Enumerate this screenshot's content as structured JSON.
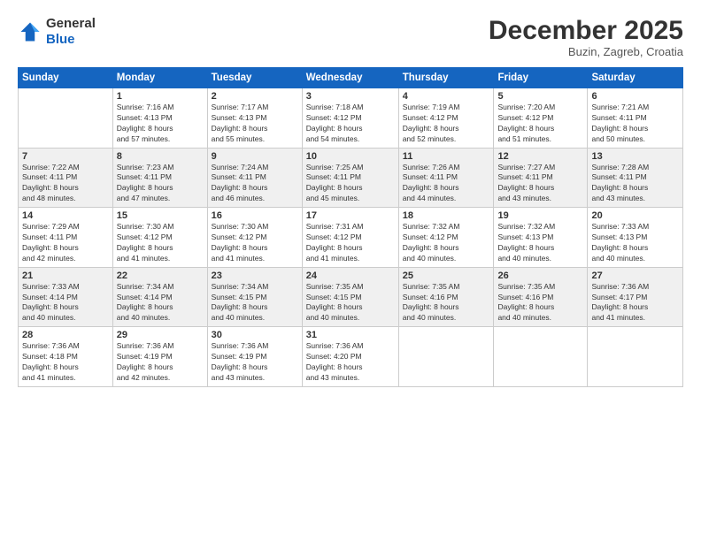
{
  "header": {
    "logo_general": "General",
    "logo_blue": "Blue",
    "month_title": "December 2025",
    "location": "Buzin, Zagreb, Croatia"
  },
  "weekdays": [
    "Sunday",
    "Monday",
    "Tuesday",
    "Wednesday",
    "Thursday",
    "Friday",
    "Saturday"
  ],
  "weeks": [
    [
      {
        "day": "",
        "info": ""
      },
      {
        "day": "1",
        "info": "Sunrise: 7:16 AM\nSunset: 4:13 PM\nDaylight: 8 hours\nand 57 minutes."
      },
      {
        "day": "2",
        "info": "Sunrise: 7:17 AM\nSunset: 4:13 PM\nDaylight: 8 hours\nand 55 minutes."
      },
      {
        "day": "3",
        "info": "Sunrise: 7:18 AM\nSunset: 4:12 PM\nDaylight: 8 hours\nand 54 minutes."
      },
      {
        "day": "4",
        "info": "Sunrise: 7:19 AM\nSunset: 4:12 PM\nDaylight: 8 hours\nand 52 minutes."
      },
      {
        "day": "5",
        "info": "Sunrise: 7:20 AM\nSunset: 4:12 PM\nDaylight: 8 hours\nand 51 minutes."
      },
      {
        "day": "6",
        "info": "Sunrise: 7:21 AM\nSunset: 4:11 PM\nDaylight: 8 hours\nand 50 minutes."
      }
    ],
    [
      {
        "day": "7",
        "info": "Sunrise: 7:22 AM\nSunset: 4:11 PM\nDaylight: 8 hours\nand 48 minutes."
      },
      {
        "day": "8",
        "info": "Sunrise: 7:23 AM\nSunset: 4:11 PM\nDaylight: 8 hours\nand 47 minutes."
      },
      {
        "day": "9",
        "info": "Sunrise: 7:24 AM\nSunset: 4:11 PM\nDaylight: 8 hours\nand 46 minutes."
      },
      {
        "day": "10",
        "info": "Sunrise: 7:25 AM\nSunset: 4:11 PM\nDaylight: 8 hours\nand 45 minutes."
      },
      {
        "day": "11",
        "info": "Sunrise: 7:26 AM\nSunset: 4:11 PM\nDaylight: 8 hours\nand 44 minutes."
      },
      {
        "day": "12",
        "info": "Sunrise: 7:27 AM\nSunset: 4:11 PM\nDaylight: 8 hours\nand 43 minutes."
      },
      {
        "day": "13",
        "info": "Sunrise: 7:28 AM\nSunset: 4:11 PM\nDaylight: 8 hours\nand 43 minutes."
      }
    ],
    [
      {
        "day": "14",
        "info": "Sunrise: 7:29 AM\nSunset: 4:11 PM\nDaylight: 8 hours\nand 42 minutes."
      },
      {
        "day": "15",
        "info": "Sunrise: 7:30 AM\nSunset: 4:12 PM\nDaylight: 8 hours\nand 41 minutes."
      },
      {
        "day": "16",
        "info": "Sunrise: 7:30 AM\nSunset: 4:12 PM\nDaylight: 8 hours\nand 41 minutes."
      },
      {
        "day": "17",
        "info": "Sunrise: 7:31 AM\nSunset: 4:12 PM\nDaylight: 8 hours\nand 41 minutes."
      },
      {
        "day": "18",
        "info": "Sunrise: 7:32 AM\nSunset: 4:12 PM\nDaylight: 8 hours\nand 40 minutes."
      },
      {
        "day": "19",
        "info": "Sunrise: 7:32 AM\nSunset: 4:13 PM\nDaylight: 8 hours\nand 40 minutes."
      },
      {
        "day": "20",
        "info": "Sunrise: 7:33 AM\nSunset: 4:13 PM\nDaylight: 8 hours\nand 40 minutes."
      }
    ],
    [
      {
        "day": "21",
        "info": "Sunrise: 7:33 AM\nSunset: 4:14 PM\nDaylight: 8 hours\nand 40 minutes."
      },
      {
        "day": "22",
        "info": "Sunrise: 7:34 AM\nSunset: 4:14 PM\nDaylight: 8 hours\nand 40 minutes."
      },
      {
        "day": "23",
        "info": "Sunrise: 7:34 AM\nSunset: 4:15 PM\nDaylight: 8 hours\nand 40 minutes."
      },
      {
        "day": "24",
        "info": "Sunrise: 7:35 AM\nSunset: 4:15 PM\nDaylight: 8 hours\nand 40 minutes."
      },
      {
        "day": "25",
        "info": "Sunrise: 7:35 AM\nSunset: 4:16 PM\nDaylight: 8 hours\nand 40 minutes."
      },
      {
        "day": "26",
        "info": "Sunrise: 7:35 AM\nSunset: 4:16 PM\nDaylight: 8 hours\nand 40 minutes."
      },
      {
        "day": "27",
        "info": "Sunrise: 7:36 AM\nSunset: 4:17 PM\nDaylight: 8 hours\nand 41 minutes."
      }
    ],
    [
      {
        "day": "28",
        "info": "Sunrise: 7:36 AM\nSunset: 4:18 PM\nDaylight: 8 hours\nand 41 minutes."
      },
      {
        "day": "29",
        "info": "Sunrise: 7:36 AM\nSunset: 4:19 PM\nDaylight: 8 hours\nand 42 minutes."
      },
      {
        "day": "30",
        "info": "Sunrise: 7:36 AM\nSunset: 4:19 PM\nDaylight: 8 hours\nand 43 minutes."
      },
      {
        "day": "31",
        "info": "Sunrise: 7:36 AM\nSunset: 4:20 PM\nDaylight: 8 hours\nand 43 minutes."
      },
      {
        "day": "",
        "info": ""
      },
      {
        "day": "",
        "info": ""
      },
      {
        "day": "",
        "info": ""
      }
    ]
  ]
}
